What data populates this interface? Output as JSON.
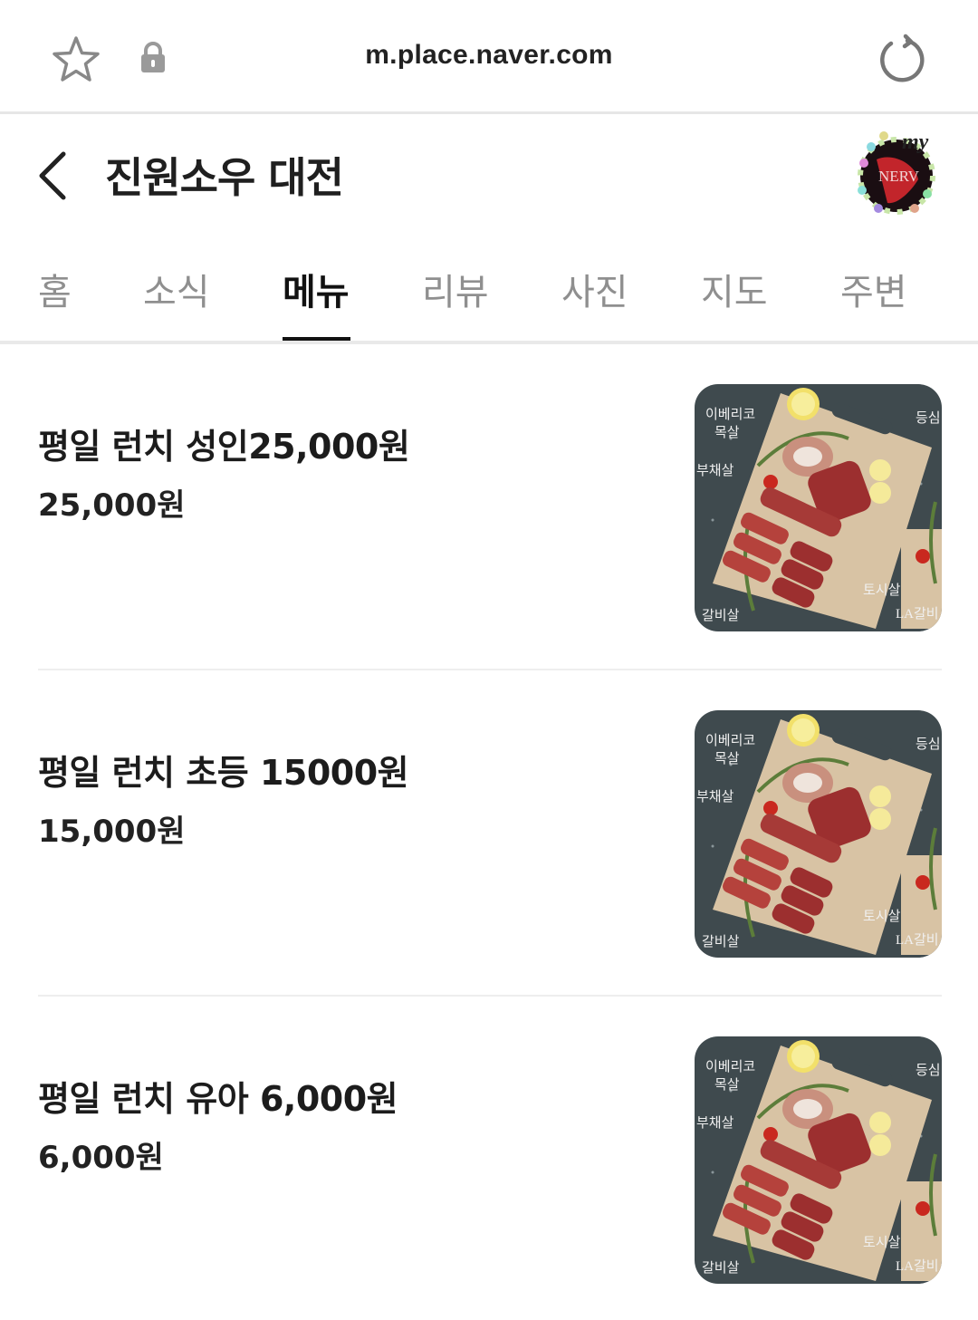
{
  "browser": {
    "url": "m.place.naver.com"
  },
  "header": {
    "title": "진원소우 대전",
    "avatar_text": "my",
    "avatar_logo_text": "NERV"
  },
  "tabs": [
    {
      "label": "홈",
      "active": false
    },
    {
      "label": "소식",
      "active": false
    },
    {
      "label": "메뉴",
      "active": true
    },
    {
      "label": "리뷰",
      "active": false
    },
    {
      "label": "사진",
      "active": false
    },
    {
      "label": "지도",
      "active": false
    },
    {
      "label": "주변",
      "active": false
    }
  ],
  "menu": [
    {
      "name": "평일 런치 성인25,000원",
      "price": "25,000원"
    },
    {
      "name": "평일 런치 초등 15000원",
      "price": "15,000원"
    },
    {
      "name": "평일 런치 유아 6,000원",
      "price": "6,000원"
    }
  ],
  "thumb_labels": {
    "iberico": "이베리코",
    "moksal": "목살",
    "deungsim": "등심",
    "buchaesal": "부채살",
    "tosisal": "토시살",
    "galbisal": "갈비살",
    "la_galbi": "LA갈비"
  },
  "colors": {
    "text_primary": "#1c1c1c",
    "tab_inactive": "#8f8f8f",
    "tab_active": "#111111",
    "divider": "#eeeeee",
    "board_bg": "#3f4a4e"
  }
}
